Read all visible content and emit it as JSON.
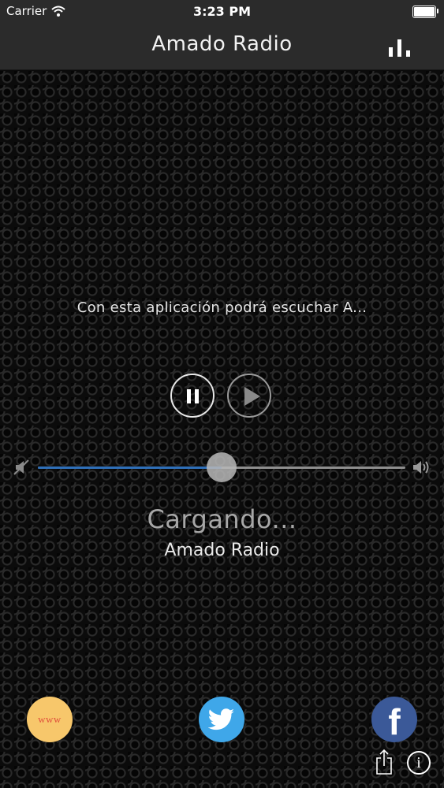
{
  "status_bar": {
    "carrier": "Carrier",
    "time": "3:23 PM"
  },
  "navbar": {
    "title": "Amado Radio"
  },
  "player": {
    "description": "Con esta aplicación podrá escuchar A...",
    "volume_level": 0.5,
    "status": "Cargando...",
    "station": "Amado Radio"
  },
  "links": {
    "www_label": "www"
  },
  "icons": [
    "wifi-icon",
    "battery-icon",
    "equalizer-icon",
    "pause-icon",
    "play-icon",
    "mute-icon",
    "volume-icon",
    "twitter-icon",
    "facebook-icon",
    "share-icon",
    "info-icon"
  ],
  "colors": {
    "bar_bg": "#2b2b2b",
    "slider_fill": "#2f6fb8",
    "www_bg": "#f7c76b",
    "twitter_bg": "#3fa7e9",
    "facebook_bg": "#3b5998"
  }
}
